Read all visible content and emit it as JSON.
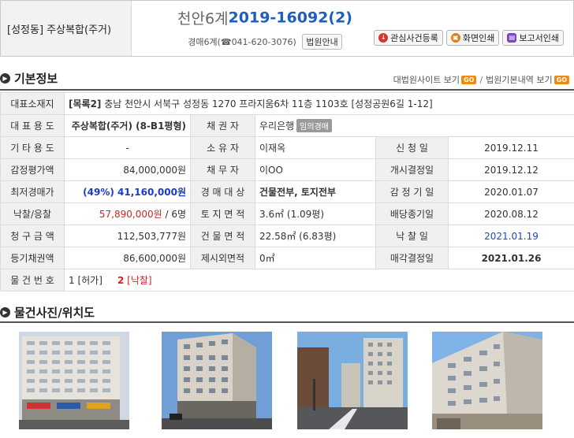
{
  "header": {
    "region_type": "[성정동] 주상복합(주거)",
    "court_name": "천안6계",
    "case_number": "2019-16092(2)",
    "dept_label": "경매6계",
    "phone": "041-620-3076",
    "court_info_button": "법원안내",
    "buttons": {
      "interest": "관심사건등록",
      "print": "화면인쇄",
      "report": "보고서인쇄"
    }
  },
  "basic_info": {
    "title": "기본정보",
    "links": {
      "court_site": "대법원사이트 보기",
      "court_detail": "법원기본내역 보기",
      "go": "GO"
    }
  },
  "table": {
    "rep_location_label": "대표소재지",
    "rep_location_tag": "[목록2]",
    "rep_location_value": " 충남 천안시 서북구 성정동 1270 프라지움6차 11층 1103호 [성정공원6길 1-12]",
    "rows": [
      {
        "l1": "대 표 용 도",
        "v1": "주상복합(주거) (8-B1평형)",
        "l2": "채 권 자",
        "v2": "우리은행",
        "v2_badge": "임의경매"
      },
      {
        "l1": "기 타 용 도",
        "v1": "-",
        "l2": "소 유 자",
        "v2": "이재옥",
        "l3": "신 청 일",
        "v3": "2019.12.11"
      },
      {
        "l1": "감정평가액",
        "v1": "84,000,000원",
        "l2": "채 무 자",
        "v2": "이OO",
        "l3": "개시결정일",
        "v3": "2019.12.12"
      },
      {
        "l1": "최저경매가",
        "v1": "(49%) 41,160,000원",
        "l2": "경 매 대 상",
        "v2": "건물전부, 토지전부",
        "l3": "감 정 기 일",
        "v3": "2020.01.07"
      },
      {
        "l1": "낙찰/응찰",
        "v1": "57,890,000원",
        "v1_suffix": " / 6명",
        "l2": "토 지 면 적",
        "v2": "3.6㎡ (1.09평)",
        "l3": "배당종기일",
        "v3": "2020.08.12"
      },
      {
        "l1": "청 구 금 액",
        "v1": "112,503,777원",
        "l2": "건 물 면 적",
        "v2": "22.58㎡ (6.83평)",
        "l3": "낙 찰 일",
        "v3": "2021.01.19"
      },
      {
        "l1": "등기채권액",
        "v1": "86,600,000원",
        "l2": "제시외면적",
        "v2": "0㎡",
        "l3": "매각결정일",
        "v3": "2021.01.26"
      }
    ],
    "items_label": "물 건 번 호",
    "item1": "1 [허가]",
    "item2_num": "2",
    "item2_status": " [낙찰]"
  },
  "photos": {
    "title": "물건사진/위치도"
  },
  "colors": {
    "case_blue": "#1d5fbf",
    "min_price_blue": "#1a3cc8",
    "winning_red": "#d92020",
    "go_orange": "#f08a0c"
  }
}
